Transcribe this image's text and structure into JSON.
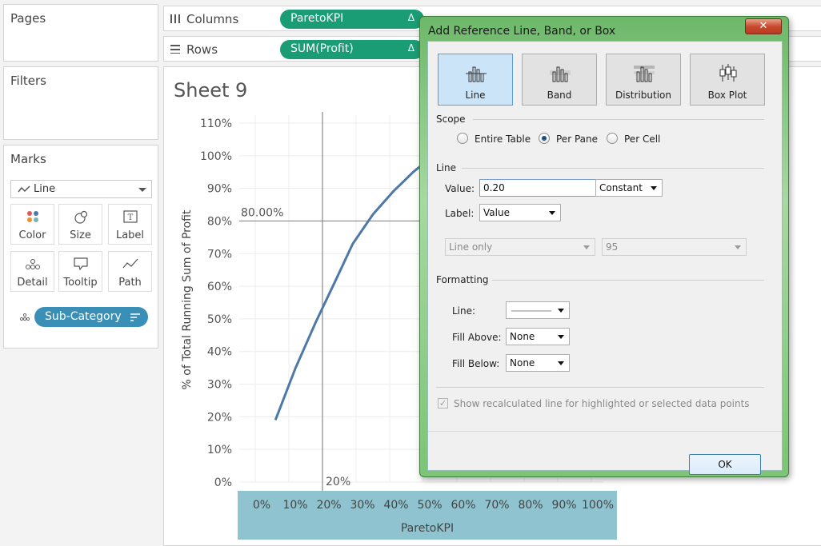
{
  "left": {
    "pages_title": "Pages",
    "filters_title": "Filters",
    "marks_title": "Marks",
    "mark_type": "Line",
    "mark_buttons": [
      {
        "label": "Color",
        "icon": "color-icon"
      },
      {
        "label": "Size",
        "icon": "size-icon"
      },
      {
        "label": "Label",
        "icon": "label-icon"
      },
      {
        "label": "Detail",
        "icon": "detail-icon"
      },
      {
        "label": "Tooltip",
        "icon": "tooltip-icon"
      },
      {
        "label": "Path",
        "icon": "path-icon"
      }
    ],
    "detail_pill": "Sub-Category"
  },
  "shelves": {
    "columns_label": "Columns",
    "columns_pill": "ParetoKPI",
    "rows_label": "Rows",
    "rows_pill": "SUM(Profit)",
    "delta_symbol": "Δ"
  },
  "sheet": {
    "title": "Sheet 9"
  },
  "chart_data": {
    "type": "line",
    "title": "",
    "xlabel": "ParetoKPI",
    "ylabel": "% of Total Running Sum of Profit",
    "x_ticks": [
      "0%",
      "10%",
      "20%",
      "30%",
      "40%",
      "50%",
      "60%",
      "70%",
      "80%",
      "90%",
      "100%"
    ],
    "y_ticks": [
      "0%",
      "10%",
      "20%",
      "30%",
      "40%",
      "50%",
      "60%",
      "70%",
      "80%",
      "90%",
      "100%",
      "110%"
    ],
    "xlim": [
      0,
      1.0
    ],
    "ylim": [
      0,
      1.1
    ],
    "grid": true,
    "series": [
      {
        "x": [
          0.06,
          0.12,
          0.18,
          0.24,
          0.29,
          0.35,
          0.41,
          0.47,
          0.53
        ],
        "y": [
          0.19,
          0.35,
          0.49,
          0.62,
          0.73,
          0.82,
          0.89,
          0.95,
          1.0
        ],
        "color": "#4e79a7"
      }
    ],
    "reference_lines": [
      {
        "axis": "y",
        "value": 0.8,
        "label": "80.00%"
      },
      {
        "axis": "x",
        "value": 0.2,
        "label": "20%"
      }
    ]
  },
  "dialog": {
    "title": "Add Reference Line, Band, or Box",
    "close_glyph": "✕",
    "types": [
      {
        "label": "Line",
        "icon": "reference-line-icon",
        "selected": true
      },
      {
        "label": "Band",
        "icon": "reference-band-icon",
        "selected": false
      },
      {
        "label": "Distribution",
        "icon": "distribution-icon",
        "selected": false
      },
      {
        "label": "Box Plot",
        "icon": "box-plot-icon",
        "selected": false
      }
    ],
    "scope": {
      "title": "Scope",
      "options": [
        "Entire Table",
        "Per Pane",
        "Per Cell"
      ],
      "selected": "Per Pane"
    },
    "line": {
      "title": "Line",
      "value_label": "Value:",
      "value": "0.20",
      "value_type": "Constant",
      "label_label": "Label:",
      "label_value": "Value",
      "disabled_1": "Line only",
      "disabled_2": "95"
    },
    "formatting": {
      "title": "Formatting",
      "line_label": "Line:",
      "fill_above_label": "Fill Above:",
      "fill_above": "None",
      "fill_below_label": "Fill Below:",
      "fill_below": "None"
    },
    "recalc_checkbox": "Show recalculated line for highlighted or selected data points",
    "ok": "OK"
  }
}
